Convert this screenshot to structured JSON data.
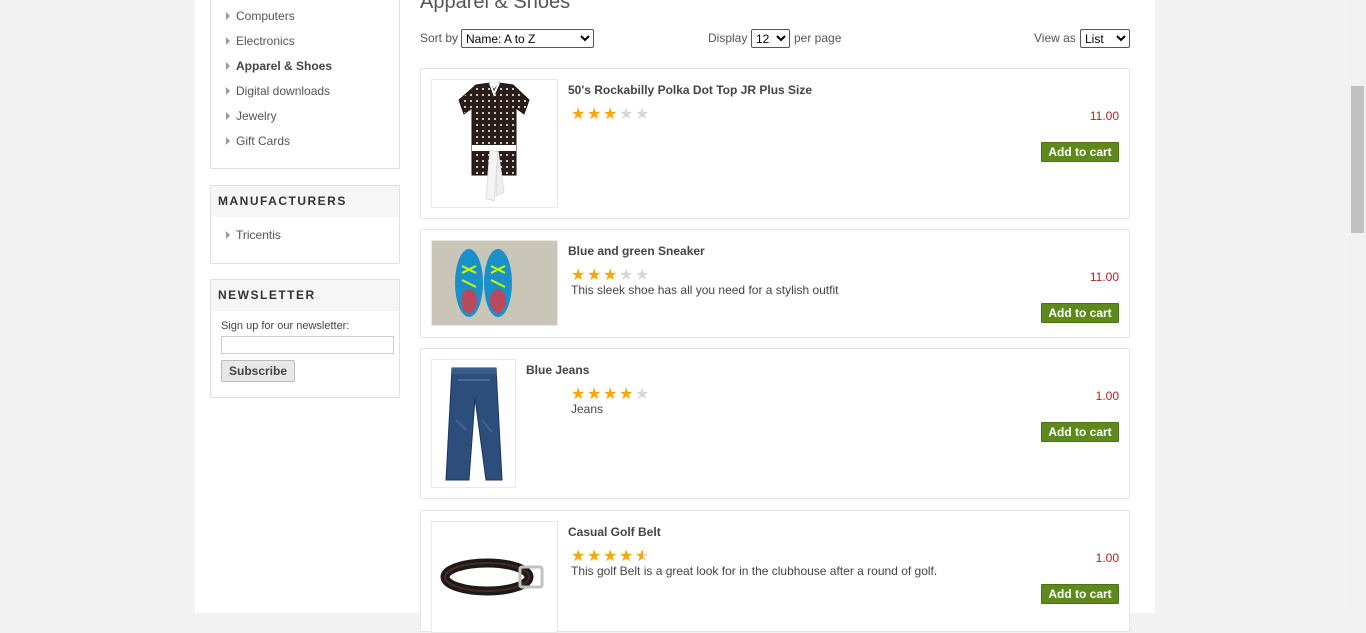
{
  "categories": [
    {
      "label": "Computers",
      "active": false
    },
    {
      "label": "Electronics",
      "active": false
    },
    {
      "label": "Apparel & Shoes",
      "active": true
    },
    {
      "label": "Digital downloads",
      "active": false
    },
    {
      "label": "Jewelry",
      "active": false
    },
    {
      "label": "Gift Cards",
      "active": false
    }
  ],
  "manufacturers": {
    "title": "MANUFACTURERS",
    "items": [
      "Tricentis"
    ]
  },
  "newsletter": {
    "title": "NEWSLETTER",
    "label": "Sign up for our newsletter:",
    "email_value": "",
    "subscribe_label": "Subscribe"
  },
  "main": {
    "title": "Apparel & Shoes",
    "sort_label": "Sort by",
    "sort_selected": "Name: A to Z",
    "display_label": "Display",
    "display_selected": "12",
    "per_page_label": "per page",
    "view_label": "View as",
    "view_selected": "List"
  },
  "products": [
    {
      "title": "50's Rockabilly Polka Dot Top JR Plus Size",
      "rating": 3,
      "description": "",
      "price": "11.00",
      "cart_label": "Add to cart",
      "image": "polka-dot-top"
    },
    {
      "title": "Blue and green Sneaker",
      "rating": 3,
      "description": "This sleek shoe has all you need for a stylish outfit",
      "price": "11.00",
      "cart_label": "Add to cart",
      "image": "sneaker"
    },
    {
      "title": "Blue Jeans",
      "rating": 4,
      "description": "Jeans",
      "price": "1.00",
      "cart_label": "Add to cart",
      "image": "jeans"
    },
    {
      "title": "Casual Golf Belt",
      "rating": 4.5,
      "description": "This golf Belt is a great look for in the clubhouse after a round of golf.",
      "price": "1.00",
      "cart_label": "Add to cart",
      "image": "belt"
    }
  ],
  "colors": {
    "accent_green": "#5d8a1a",
    "price_red": "#b22222",
    "star_gold": "#f5a700"
  }
}
